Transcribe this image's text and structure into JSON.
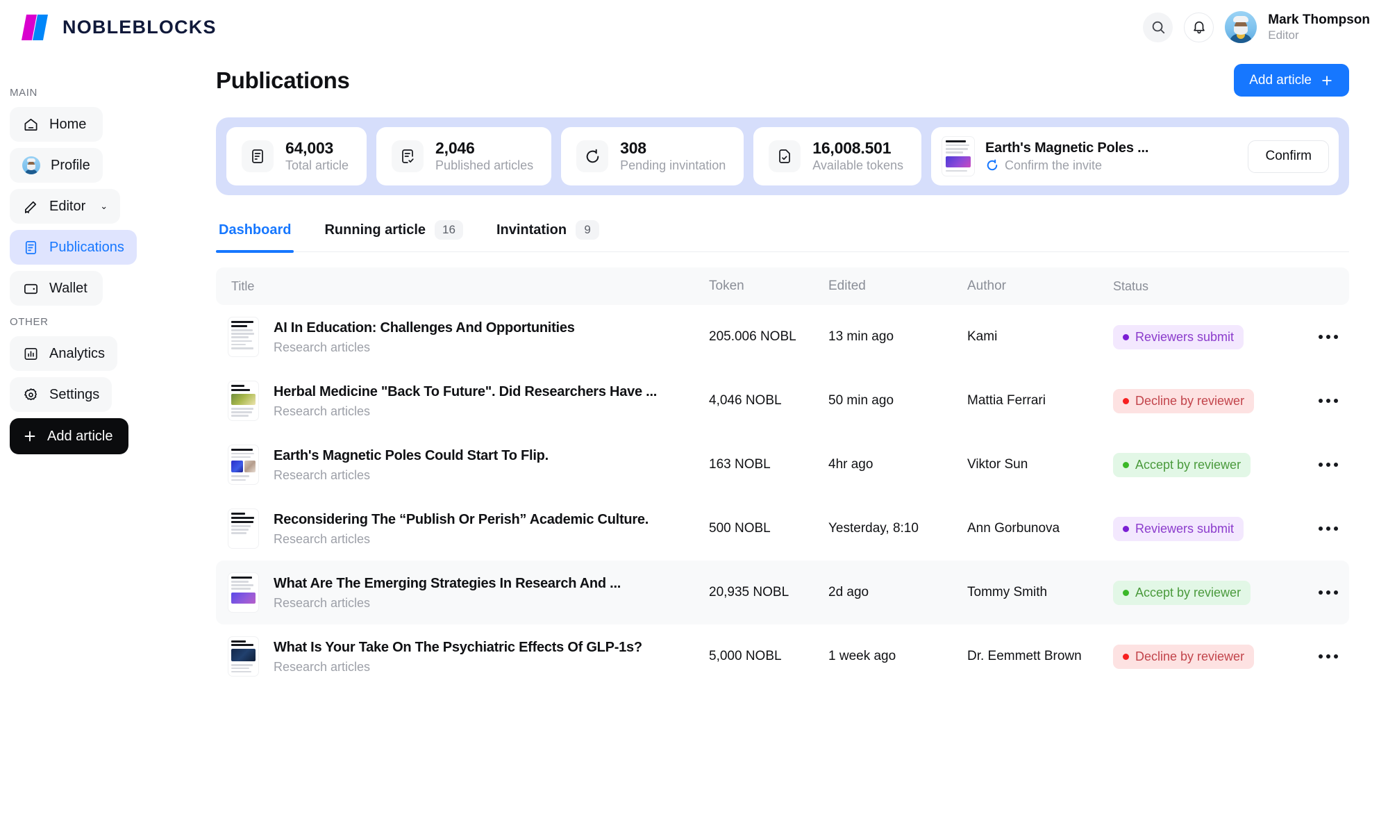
{
  "brand": {
    "name": "NOBLEBLOCKS"
  },
  "topbar": {
    "search_icon": "search-icon",
    "bell_icon": "bell-icon",
    "user_name": "Mark Thompson",
    "user_role": "Editor"
  },
  "sidebar": {
    "group_main_label": "MAIN",
    "group_other_label": "OTHER",
    "main_items": [
      {
        "label": "Home",
        "icon": "home-icon",
        "active": false
      },
      {
        "label": "Profile",
        "icon": "avatar-icon",
        "active": false
      },
      {
        "label": "Editor",
        "icon": "pencil-icon",
        "active": false,
        "chevron": "⌄"
      },
      {
        "label": "Publications",
        "icon": "document-icon",
        "active": true
      },
      {
        "label": "Wallet",
        "icon": "wallet-icon",
        "active": false
      }
    ],
    "other_items": [
      {
        "label": "Analytics",
        "icon": "bar-chart-icon"
      },
      {
        "label": "Settings",
        "icon": "gear-icon"
      }
    ],
    "add_article_label": "Add article"
  },
  "page": {
    "title": "Publications",
    "add_article_label": "Add article"
  },
  "stats": [
    {
      "value": "64,003",
      "label": "Total article",
      "icon": "document-icon"
    },
    {
      "value": "2,046",
      "label": "Published articles",
      "icon": "document-check-icon"
    },
    {
      "value": "308",
      "label": "Pending invintation",
      "icon": "refresh-icon"
    },
    {
      "value": "16,008.501",
      "label": "Available tokens",
      "icon": "file-check-icon"
    }
  ],
  "invite": {
    "title": "Earth's Magnetic Poles ...",
    "subtitle": "Confirm the invite",
    "spinner_icon": "spinner-icon",
    "confirm_label": "Confirm"
  },
  "tabs": [
    {
      "label": "Dashboard",
      "count": "",
      "active": true
    },
    {
      "label": "Running article",
      "count": "16",
      "active": false
    },
    {
      "label": "Invintation",
      "count": "9",
      "active": false
    }
  ],
  "table": {
    "columns": [
      "Title",
      "Token",
      "Edited",
      "Author",
      "Status"
    ],
    "rows": [
      {
        "title": "AI In Education: Challenges And Opportunities",
        "subtitle": "Research articles",
        "token": "205.006 NOBL",
        "edited": "13 min ago",
        "author": "Kami",
        "status": "Reviewers submit",
        "status_type": "purple",
        "highlight": false,
        "thumb": "text-only"
      },
      {
        "title": "Herbal Medicine \"Back To Future\". Did Researchers Have ...",
        "subtitle": "Research articles",
        "token": "4,046 NOBL",
        "edited": "50 min ago",
        "author": "Mattia Ferrari",
        "status": "Decline by reviewer",
        "status_type": "red",
        "highlight": false,
        "thumb": "mushroom"
      },
      {
        "title": "Earth's Magnetic Poles Could Start To Flip.",
        "subtitle": "Research articles",
        "token": "163 NOBL",
        "edited": "4hr ago",
        "author": "Viktor Sun",
        "status": "Accept by reviewer",
        "status_type": "green",
        "highlight": false,
        "thumb": "two-image"
      },
      {
        "title": "Reconsidering The “Publish Or Perish” Academic Culture.",
        "subtitle": "Research articles",
        "token": "500 NOBL",
        "edited": "Yesterday, 8:10",
        "author": "Ann Gorbunova",
        "status": "Reviewers submit",
        "status_type": "purple",
        "highlight": false,
        "thumb": "text-only"
      },
      {
        "title": "What Are The Emerging Strategies In Research And ...",
        "subtitle": "Research articles",
        "token": "20,935 NOBL",
        "edited": "2d ago",
        "author": "Tommy Smith",
        "status": "Accept by reviewer",
        "status_type": "green",
        "highlight": true,
        "thumb": "purple-brain"
      },
      {
        "title": "What Is Your Take On The Psychiatric Effects Of GLP-1s?",
        "subtitle": "Research articles",
        "token": "5,000 NOBL",
        "edited": "1 week ago",
        "author": "Dr. Eemmett Brown",
        "status": "Decline by reviewer",
        "status_type": "red",
        "highlight": false,
        "thumb": "dark-blue"
      }
    ],
    "row_menu_icon": "more-horizontal-icon"
  },
  "colors": {
    "accent": "#1677FF",
    "band": "#D6DEFB",
    "status_purple": "#8B3BCC",
    "status_red": "#C2444B",
    "status_green": "#4A9A3C"
  }
}
